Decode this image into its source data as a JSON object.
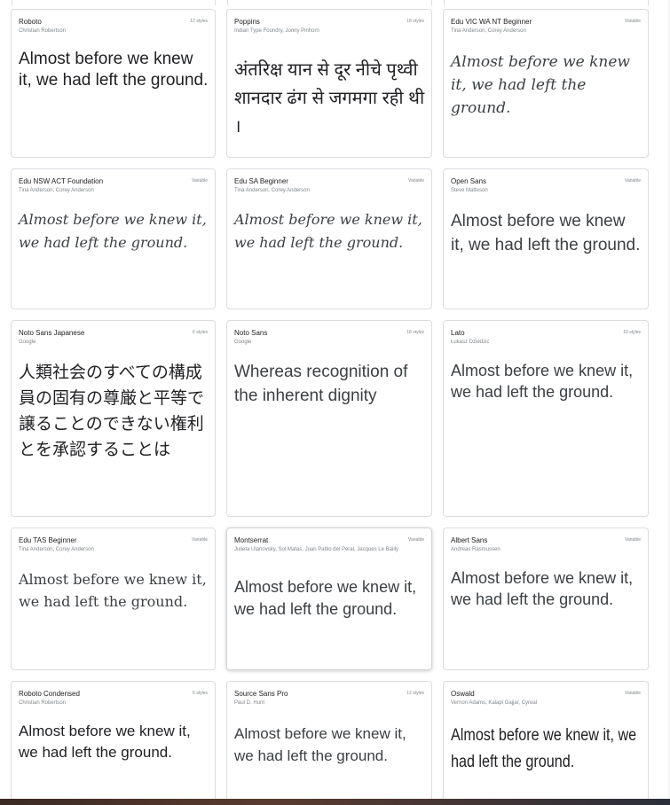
{
  "cards": [
    {
      "name": "Roboto",
      "author": "Christian Robertson",
      "badge": "12 styles",
      "sample": "Almost before we knew it, we had left the ground."
    },
    {
      "name": "Poppins",
      "author": "Indian Type Foundry, Jonny Pinhorn",
      "badge": "18 styles",
      "sample": "अंतरिक्ष यान से दूर नीचे पृथ्वी शानदार ढंग से जगमगा रही थी ।"
    },
    {
      "name": "Edu VIC WA NT Beginner",
      "author": "Tina Anderson, Corey Anderson",
      "badge": "Variable",
      "sample": "Almost before we knew it, we had left the ground."
    },
    {
      "name": "Edu NSW ACT Foundation",
      "author": "Tina Anderson, Corey Anderson",
      "badge": "Variable",
      "sample": "Almost before we knew it, we had left the ground."
    },
    {
      "name": "Edu SA Beginner",
      "author": "Tina Anderson, Corey Anderson",
      "badge": "Variable",
      "sample": "Almost before we knew it, we had left the ground."
    },
    {
      "name": "Open Sans",
      "author": "Steve Matteson",
      "badge": "Variable",
      "sample": "Almost before we knew it, we had left the ground."
    },
    {
      "name": "Noto Sans Japanese",
      "author": "Google",
      "badge": "6 styles",
      "sample": "人類社会のすべての構成員の固有の尊厳と平等で譲ることのできない権利とを承認することは"
    },
    {
      "name": "Noto Sans",
      "author": "Google",
      "badge": "18 styles",
      "sample": "Whereas recognition of the inherent dignity"
    },
    {
      "name": "Lato",
      "author": "Łukasz Dziedzic",
      "badge": "10 styles",
      "sample": "Almost before we knew it, we had left the ground."
    },
    {
      "name": "Edu TAS Beginner",
      "author": "Tina Anderson, Corey Anderson",
      "badge": "Variable",
      "sample": "Almost before we knew it, we had left the ground."
    },
    {
      "name": "Montserrat",
      "author": "Julieta Ulanovsky, Sol Matas, Juan Pablo del Peral, Jacques Le Bailly",
      "badge": "Variable",
      "sample": "Almost before we knew it, we had left the ground."
    },
    {
      "name": "Albert Sans",
      "author": "Andreas Rasmussen",
      "badge": "Variable",
      "sample": "Almost before we knew it, we had left the ground."
    },
    {
      "name": "Roboto Condensed",
      "author": "Christian Robertson",
      "badge": "6 styles",
      "sample": "Almost before we knew it, we had left the ground."
    },
    {
      "name": "Source Sans Pro",
      "author": "Paul D. Hunt",
      "badge": "12 styles",
      "sample": "Almost before we knew it, we had left the ground."
    },
    {
      "name": "Oswald",
      "author": "Vernon Adams, Kalapi Gajjar, Cyreal",
      "badge": "Variable",
      "sample": "Almost before we knew it, we had left the ground."
    }
  ]
}
